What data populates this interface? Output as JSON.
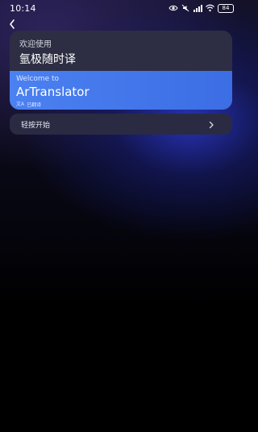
{
  "status_bar": {
    "time": "10:14",
    "battery": "84",
    "icons": [
      "eye-icon",
      "mute-icon",
      "signal-icon",
      "wifi-icon"
    ]
  },
  "back": {
    "icon": "back-chevron-icon"
  },
  "card": {
    "welcome_label": "欢迎使用",
    "app_name": "氩极随时译",
    "translation_source": "Welcome to",
    "translation_text": "ArTranslator",
    "translated_icon": "文A",
    "translated_label": "已翻译"
  },
  "start": {
    "label": "轻按开始",
    "icon": "chevron-right-icon"
  },
  "colors": {
    "accent_blue": "#4b81f1",
    "card_background": "#2d2e43",
    "row_background": "#2a2b43"
  }
}
